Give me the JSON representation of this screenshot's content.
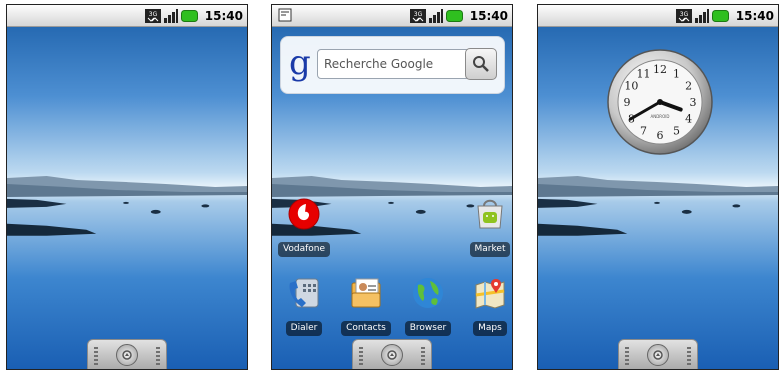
{
  "status_bar": {
    "time": "15:40",
    "network_label": "3G"
  },
  "screens": [
    {
      "name": "home-screen-empty"
    },
    {
      "name": "home-screen-apps",
      "search": {
        "brand_letter": "g",
        "placeholder": "Recherche Google"
      },
      "apps": [
        {
          "label": "Vodafone",
          "icon": "vodafone-icon"
        },
        {
          "label": "Market",
          "icon": "market-icon"
        },
        {
          "label": "Dialer",
          "icon": "dialer-icon"
        },
        {
          "label": "Contacts",
          "icon": "contacts-icon"
        },
        {
          "label": "Browser",
          "icon": "browser-icon"
        },
        {
          "label": "Maps",
          "icon": "maps-icon"
        }
      ]
    },
    {
      "name": "home-screen-clock",
      "clock": {
        "brand": "ANDROID",
        "numerals": [
          "12",
          "1",
          "2",
          "3",
          "4",
          "5",
          "6",
          "7",
          "8",
          "9",
          "10",
          "11"
        ],
        "time": "15:40"
      }
    }
  ],
  "colors": {
    "battery": "#2fbf1f",
    "sky_top": "#1a5ea8",
    "water": "#1f70c4"
  }
}
